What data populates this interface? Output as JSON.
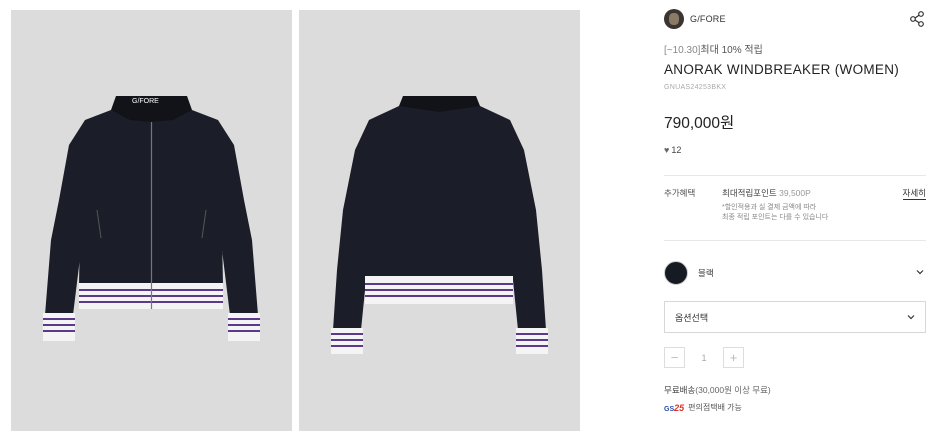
{
  "images": [
    {
      "name": "product-image-front",
      "label": "G/FORE"
    },
    {
      "name": "product-image-back"
    }
  ],
  "brand": {
    "name": "G/FORE",
    "icon": "share-icon"
  },
  "product": {
    "promo_date": "[~10.30]",
    "promo_text": "최대 10% 적립",
    "title": "ANORAK WINDBREAKER (WOMEN)",
    "sku": "GNUAS24253BKX",
    "price": "790,000원",
    "likes": "12",
    "like_icon": "heart-icon"
  },
  "benefit": {
    "label": "추가혜택",
    "points_label": "최대적립포인트",
    "points_value": "39,500P",
    "detail_link": "자세히",
    "note_line1": "*할인적용과 실 결제 금액에 따라",
    "note_line2": "최종 적립 포인트는 다를 수 있습니다"
  },
  "color": {
    "name": "블랙",
    "swatch": "#161a22"
  },
  "option": {
    "placeholder": "옵션선택"
  },
  "quantity": {
    "minus": "−",
    "value": "1",
    "plus": "+"
  },
  "shipping": {
    "label": "무료배송",
    "condition": "(30,000원 이상 무료)"
  },
  "gs": {
    "logo_text": "GS",
    "logo_num": "25",
    "text": "편의점택배 가능"
  },
  "colors": {
    "jacket": "#1b1e28",
    "stripe": "#5b3a8c",
    "rib": "#f4f4f4",
    "bg": "#dcdcdc"
  }
}
